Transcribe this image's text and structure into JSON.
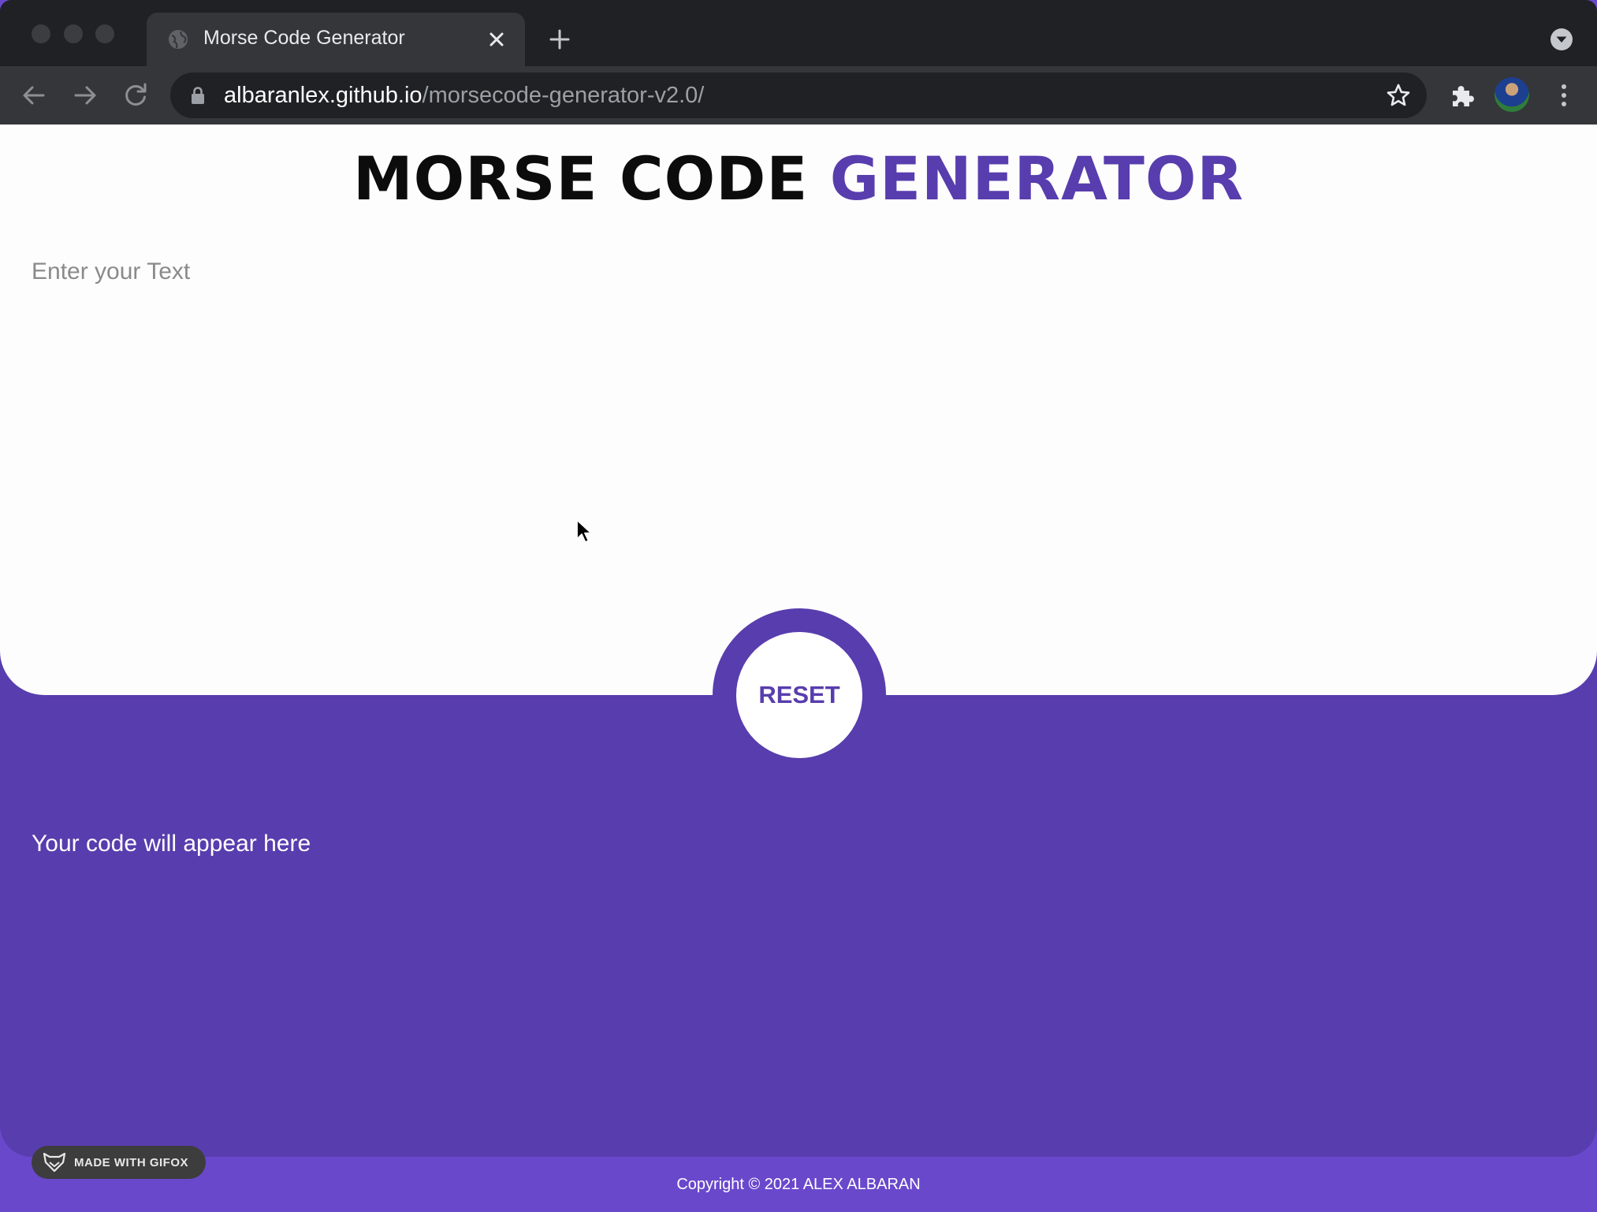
{
  "browser": {
    "tab_title": "Morse Code Generator",
    "url_host": "albaranlex.github.io",
    "url_path": "/morsecode-generator-v2.0/"
  },
  "page": {
    "title_part1": "MORSE CODE ",
    "title_part2": "GENERATOR",
    "input_placeholder": "Enter your Text",
    "input_value": "",
    "reset_label": "RESET",
    "output_placeholder": "Your code will appear here",
    "copyright": "Copyright © 2021 ALEX ALBARAN",
    "badge_label": "MADE WITH GIFOX"
  },
  "colors": {
    "accent": "#583dae",
    "footer": "#6a48cc",
    "chrome_dark": "#202124",
    "chrome_mid": "#35363a"
  },
  "icons": [
    "globe-icon",
    "close-icon",
    "plus-icon",
    "chevron-down-icon",
    "back-arrow-icon",
    "forward-arrow-icon",
    "reload-icon",
    "lock-icon",
    "star-icon",
    "puzzle-icon",
    "kebab-menu-icon",
    "fox-icon",
    "cursor-icon"
  ]
}
